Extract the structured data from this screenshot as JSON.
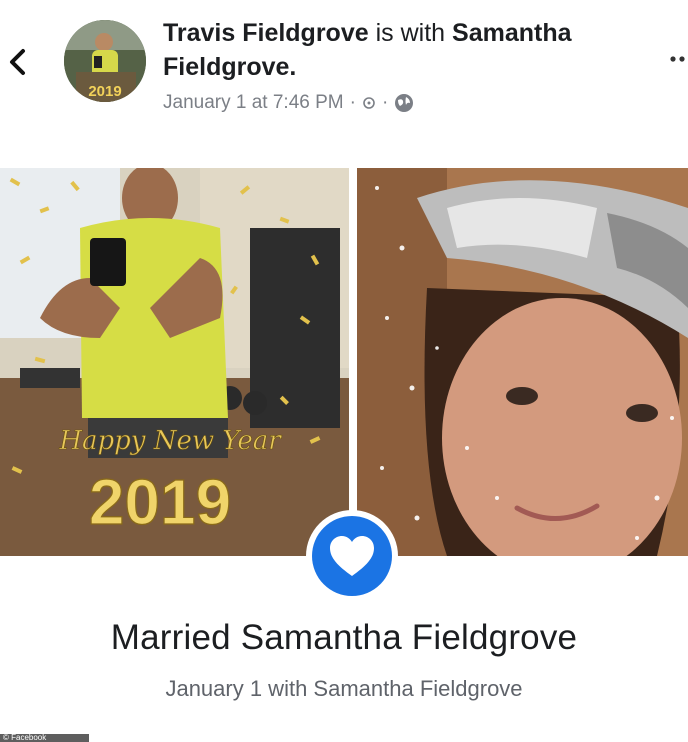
{
  "header": {
    "author": "Travis Fieldgrove",
    "connector": "is with",
    "tagged": "Samantha Fieldgrove.",
    "timestamp": "January 1 at 7:46 PM",
    "separator": "·",
    "avatar_badge": "2019"
  },
  "icons": {
    "back": "chevron-left-icon",
    "privacy_a": "small-circle-icon",
    "privacy_b": "globe-icon",
    "more": "more-dots-icon",
    "heart": "heart-icon"
  },
  "photo_left": {
    "greeting": "Happy New Year",
    "year": "2019"
  },
  "life_event": {
    "title": "Married Samantha Fieldgrove",
    "subtitle": "January 1 with Samantha Fieldgrove"
  },
  "watermark": "© Facebook",
  "colors": {
    "accent": "#1b74e4",
    "meta_text": "#7b7f86",
    "gold": "#e2c14c"
  }
}
